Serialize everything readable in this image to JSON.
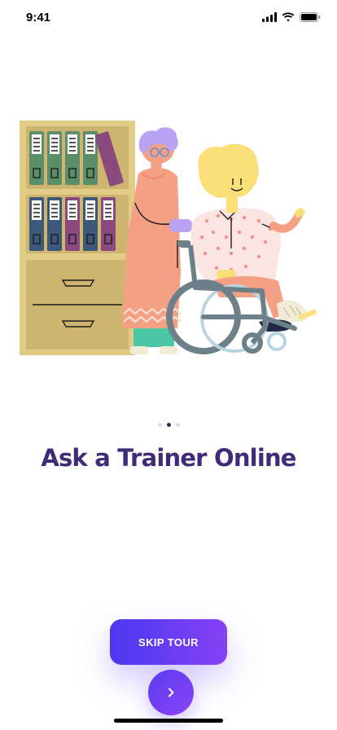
{
  "status_bar": {
    "time": "9:41"
  },
  "icons": {
    "signal": "cellular-signal-icon",
    "wifi": "wifi-icon",
    "battery": "battery-icon",
    "next": "chevron-right-icon"
  },
  "onboarding": {
    "title": "Ask a Trainer Online",
    "page_indicator": {
      "total": 3,
      "current": 2
    }
  },
  "actions": {
    "skip_label": "SKIP TOUR"
  },
  "colors": {
    "title": "#3f2b78",
    "button_gradient_start": "#4a39f0",
    "button_gradient_end": "#8741f5",
    "dot_active": "#2d2a55",
    "dot_inactive": "#dcdcec"
  }
}
